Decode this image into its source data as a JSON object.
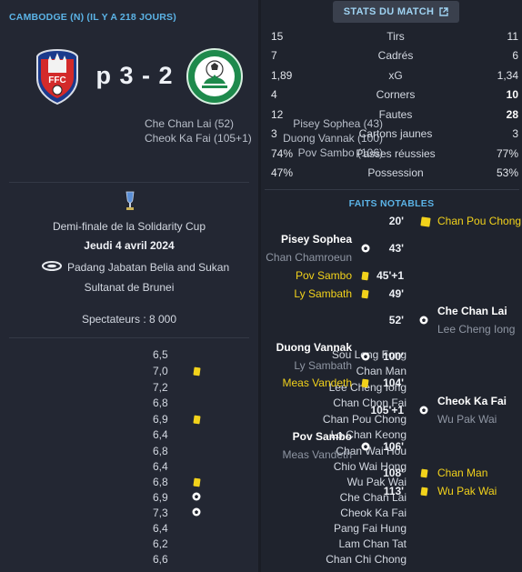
{
  "match": {
    "header": "CAMBODGE (N) (IL Y A 218 JOURS)",
    "score": "p 3 - 2",
    "home_scorers": [
      "Pisey Sophea (43)",
      "Duong Vannak (100)",
      "Pov Sambo (106)"
    ],
    "away_scorers": [
      "Che Chan Lai (52)",
      "Cheok Ka Fai (105+1)"
    ],
    "home_crest_text": "FFC",
    "competition": "Demi-finale de la Solidarity Cup",
    "date": "Jeudi 4 avril 2024",
    "stadium_line1": "Padang Jabatan Belia and Sukan",
    "stadium_line2": "Sultanat de Brunei",
    "attendance": "Spectateurs : 8 000"
  },
  "players": [
    {
      "name": "Sou Leng Fong",
      "rating": "6,5",
      "icon": ""
    },
    {
      "name": "Chan Man",
      "rating": "7,0",
      "icon": "yellow-card"
    },
    {
      "name": "Lee Cheng Iong",
      "rating": "7,2",
      "icon": ""
    },
    {
      "name": "Chan Chon Fai",
      "rating": "6,8",
      "icon": ""
    },
    {
      "name": "Chan Pou Chong",
      "rating": "6,9",
      "icon": "yellow-card"
    },
    {
      "name": "Lo Chan Keong",
      "rating": "6,4",
      "icon": ""
    },
    {
      "name": "Chan Wai Hou",
      "rating": "6,8",
      "icon": ""
    },
    {
      "name": "Chio Wai Hong",
      "rating": "6,4",
      "icon": ""
    },
    {
      "name": "Wu Pak Wai",
      "rating": "6,8",
      "icon": "yellow-card"
    },
    {
      "name": "Che Chan Lai",
      "rating": "6,9",
      "icon": "ball"
    },
    {
      "name": "Cheok Ka Fai",
      "rating": "7,3",
      "icon": "ball"
    },
    {
      "name": "Pang Fai Hung",
      "rating": "6,4",
      "icon": ""
    },
    {
      "name": "Lam Chan Tat",
      "rating": "6,2",
      "icon": ""
    },
    {
      "name": "Chan Chi Chong",
      "rating": "6,6",
      "icon": ""
    }
  ],
  "stats_button": "STATS DU MATCH",
  "stats": [
    {
      "label": "Tirs",
      "home": "15",
      "away": "11"
    },
    {
      "label": "Cadrés",
      "home": "7",
      "away": "6"
    },
    {
      "label": "xG",
      "home": "1,89",
      "away": "1,34"
    },
    {
      "label": "Corners",
      "home": "4",
      "away": "10"
    },
    {
      "label": "Fautes",
      "home": "12",
      "away": "28"
    },
    {
      "label": "Cartons jaunes",
      "home": "3",
      "away": "3"
    },
    {
      "label": "Passes réussies",
      "home": "74%",
      "away": "77%"
    },
    {
      "label": "Possession",
      "home": "47%",
      "away": "53%"
    }
  ],
  "faits_title": "FAITS NOTABLES",
  "events": [
    {
      "minute": "20'",
      "type": "yellow-card",
      "side": "away",
      "player": "Chan Pou Chong",
      "assist": ""
    },
    {
      "minute": "43'",
      "type": "goal",
      "side": "home",
      "player": "Pisey Sophea",
      "assist": "Chan Chamroeun"
    },
    {
      "minute": "45'+1",
      "type": "yellow-card",
      "side": "home",
      "player": "Pov Sambo",
      "assist": ""
    },
    {
      "minute": "49'",
      "type": "yellow-card",
      "side": "home",
      "player": "Ly Sambath",
      "assist": ""
    },
    {
      "minute": "52'",
      "type": "goal",
      "side": "away",
      "player": "Che Chan Lai",
      "assist": "Lee Cheng Iong"
    },
    {
      "minute": "100'",
      "type": "goal",
      "side": "home",
      "player": "Duong Vannak",
      "assist": "Ly Sambath"
    },
    {
      "minute": "104'",
      "type": "yellow-card",
      "side": "home",
      "player": "Meas Vandeth",
      "assist": ""
    },
    {
      "minute": "105'+1",
      "type": "goal",
      "side": "away",
      "player": "Cheok Ka Fai",
      "assist": "Wu Pak Wai"
    },
    {
      "minute": "106'",
      "type": "goal",
      "side": "home",
      "player": "Pov Sambo",
      "assist": "Meas Vandeth"
    },
    {
      "minute": "108'",
      "type": "yellow-card",
      "side": "away",
      "player": "Chan Man",
      "assist": ""
    },
    {
      "minute": "113'",
      "type": "yellow-card",
      "side": "away",
      "player": "Wu Pak Wai",
      "assist": ""
    }
  ],
  "colors": {
    "accent": "#5bb3e6",
    "yellow_card": "#f2d21b",
    "background": "#1f232d"
  }
}
